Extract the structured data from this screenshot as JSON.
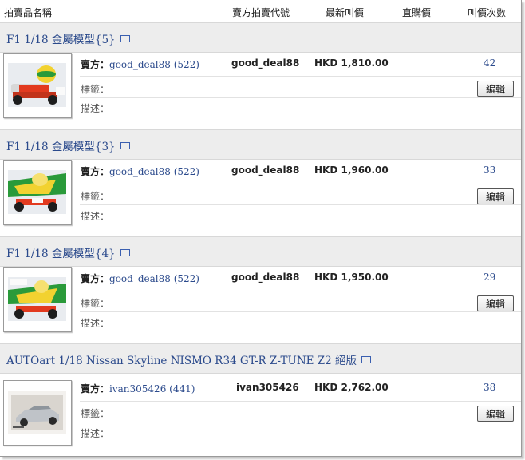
{
  "header": {
    "col_item": "拍賣品名稱",
    "col_seller_id": "賣方拍賣代號",
    "col_latest_bid": "最新叫價",
    "col_buy_now": "直購價",
    "col_bid_count": "叫價次數"
  },
  "labels": {
    "seller": "賣方：",
    "tags": "標籤：",
    "description": "描述：",
    "edit": "編輯"
  },
  "items": [
    {
      "title": "F1 1/18 金屬模型{5}",
      "seller_name": "good_deal88",
      "seller_count": "(522)",
      "seller_id": "good_deal88",
      "latest_bid": "HKD 1,810.00",
      "bids": "42"
    },
    {
      "title": "F1 1/18 金屬模型{3}",
      "seller_name": "good_deal88",
      "seller_count": "(522)",
      "seller_id": "good_deal88",
      "latest_bid": "HKD 1,960.00",
      "bids": "33"
    },
    {
      "title": "F1 1/18 金屬模型{4}",
      "seller_name": "good_deal88",
      "seller_count": "(522)",
      "seller_id": "good_deal88",
      "latest_bid": "HKD 1,950.00",
      "bids": "29"
    },
    {
      "title": "AUTOart 1/18 Nissan Skyline NISMO R34 GT-R Z-TUNE Z2 絕版",
      "seller_name": "ivan305426",
      "seller_count": "(441)",
      "seller_id": "ivan305426",
      "latest_bid": "HKD 2,762.00",
      "bids": "38"
    }
  ]
}
